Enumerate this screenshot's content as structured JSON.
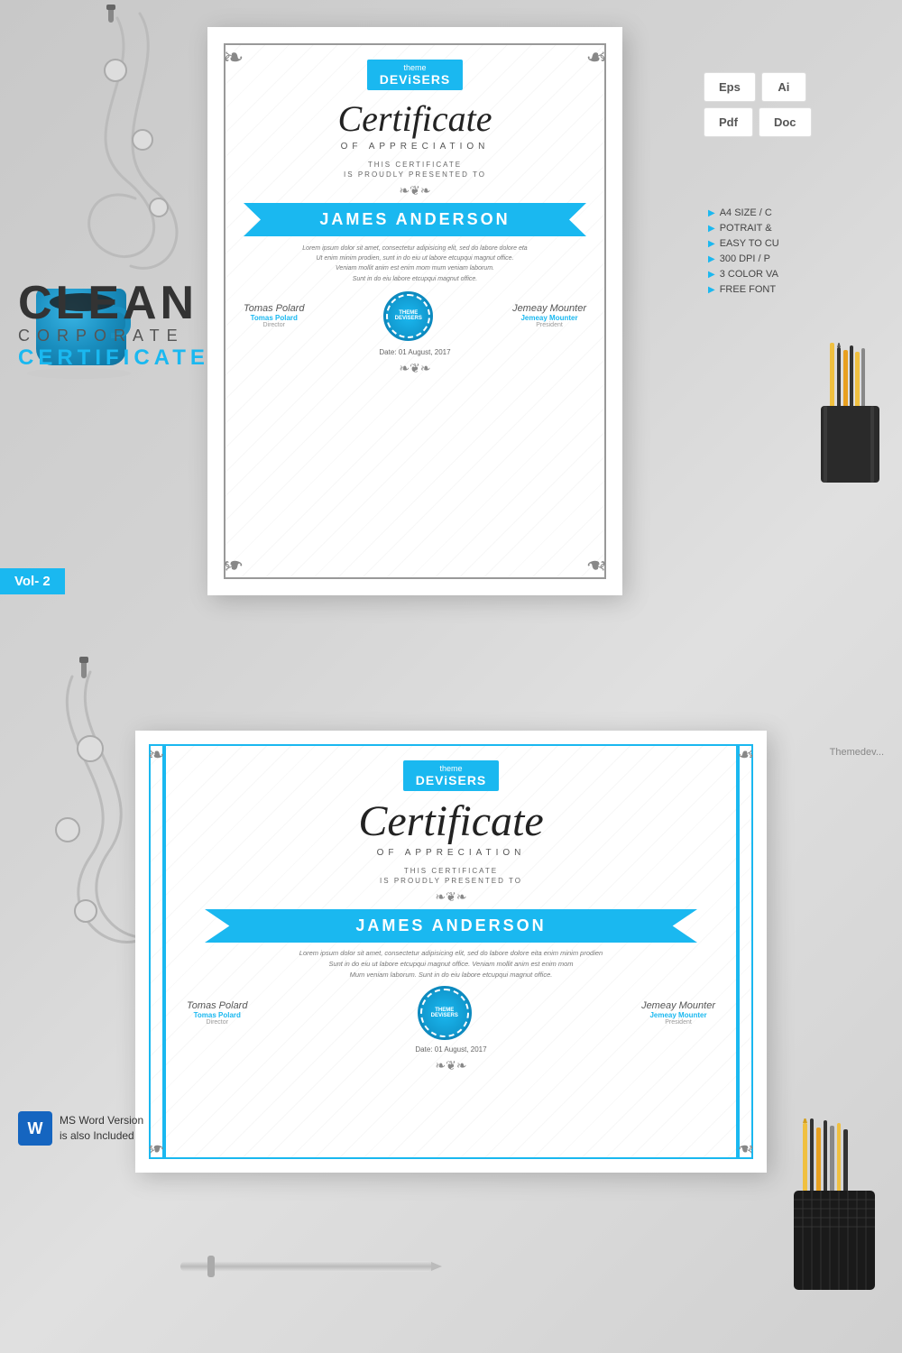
{
  "page": {
    "background_color": "#d8d8d8"
  },
  "brand": {
    "clean": "CLEAN",
    "corporate": "CORPORATE",
    "certificate": "CERTIFICATE"
  },
  "vol_badge": {
    "text": "Vol-",
    "number": "2"
  },
  "msword": {
    "icon": "W",
    "line1": "MS Word Version",
    "line2": "is also Included"
  },
  "formats": {
    "row1": [
      "Eps",
      "Ai"
    ],
    "row2": [
      "Pdf",
      "Doc"
    ]
  },
  "features": [
    "A4 SIZE / C",
    "POTRAIT &",
    "EASY TO CU",
    "300 DPI / P",
    "3 COLOR VA",
    "FREE FONT"
  ],
  "theme_label": "Themedev...",
  "certificate_portrait": {
    "logo_theme": "theme",
    "logo_devisers": "DEViSERS",
    "title": "Certificate",
    "subtitle": "OF APPRECIATION",
    "presented_line1": "THIS CERTIFICATE",
    "presented_line2": "IS PROUDLY PRESENTED TO",
    "ornament": "❧❦❧",
    "name": "JAMES ANDERSON",
    "body_text": "Lorem ipsum dolor sit amet, consectetur adipisicing elit, sed do labore dolore eta\nUt enim minim prodien, sunt in do eiu ut labore etcupqui magnut office.\nVeniam mollit anim est enim mom mum veniam laborum.\nSunt in do eiu labore etcupqui magnut office.",
    "sig1_name": "Tomas Polard",
    "sig1_role_label": "Tomas Polard",
    "sig1_role": "Director",
    "sig2_name": "Jemeay Mounter",
    "sig2_role_label": "Jemeay Mounter",
    "sig2_role": "President",
    "seal_text": "THEME\nDEViSERS",
    "date_label": "Date: 01 August, 2017",
    "bottom_ornament": "❧❦❧"
  },
  "certificate_landscape": {
    "logo_theme": "theme",
    "logo_devisers": "DEViSERS",
    "title": "Certificate",
    "subtitle": "OF APPRECIATION",
    "presented_line1": "THIS CERTIFICATE",
    "presented_line2": "IS PROUDLY PRESENTED TO",
    "ornament": "❧❦❧",
    "name": "JAMES ANDERSON",
    "body_text": "Lorem ipsum dolor sit amet, consectetur adipisicing elit, sed do labore dolore eita enim minim prodien\nSunt in do eiu ut labore etcupqui magnut office. Veniam mollit anim est enim mom\nMum veniam laborum. Sunt in do eiu labore etcupqui magnut office.",
    "sig1_name": "Tomas Polard",
    "sig1_role": "Director",
    "sig2_name": "Jemeay Mounter",
    "sig2_role": "President",
    "seal_text": "THEME\nDEViSERS",
    "date_label": "Date: 01 August, 2017"
  }
}
